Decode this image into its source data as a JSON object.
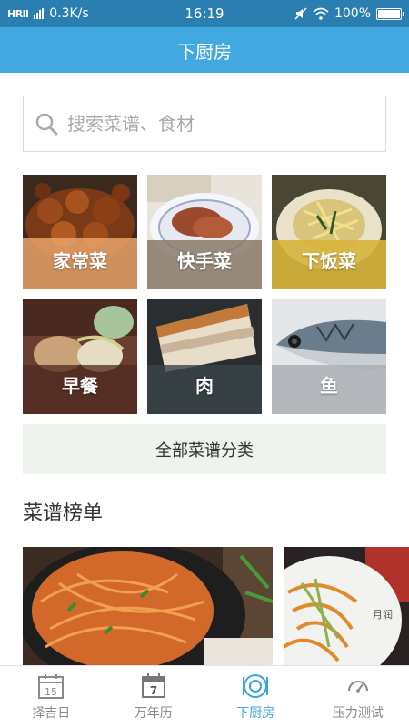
{
  "status_bar": {
    "network": "HRll",
    "speed": "0.3K/s",
    "time": "16:19",
    "battery": "100%"
  },
  "header": {
    "title": "下厨房"
  },
  "search": {
    "placeholder": "搜索菜谱、食材"
  },
  "categories": [
    {
      "label": "家常菜",
      "icon": "braised-pork-photo"
    },
    {
      "label": "快手菜",
      "icon": "meat-plate-photo"
    },
    {
      "label": "下饭菜",
      "icon": "shredded-dish-photo"
    },
    {
      "label": "早餐",
      "icon": "breakfast-photo"
    },
    {
      "label": "肉",
      "icon": "pork-belly-photo"
    },
    {
      "label": "鱼",
      "icon": "fish-photo"
    }
  ],
  "all_categories": {
    "label": "全部菜谱分类"
  },
  "ranking": {
    "title": "菜谱榜单",
    "cards": [
      {
        "icon": "noodles-photo"
      },
      {
        "icon": "stir-fry-photo"
      }
    ]
  },
  "tabs": [
    {
      "label": "择吉日",
      "icon": "calendar-15-icon",
      "active": false
    },
    {
      "label": "万年历",
      "icon": "calendar-7-icon",
      "active": false
    },
    {
      "label": "下厨房",
      "icon": "kitchen-icon",
      "active": true
    },
    {
      "label": "压力测试",
      "icon": "gauge-icon",
      "active": false
    }
  ],
  "colors": {
    "status_bar": "#2a7fb0",
    "header": "#41a9df",
    "active_tab": "#3ba6dc",
    "inactive_tab": "#8a8a8a"
  }
}
